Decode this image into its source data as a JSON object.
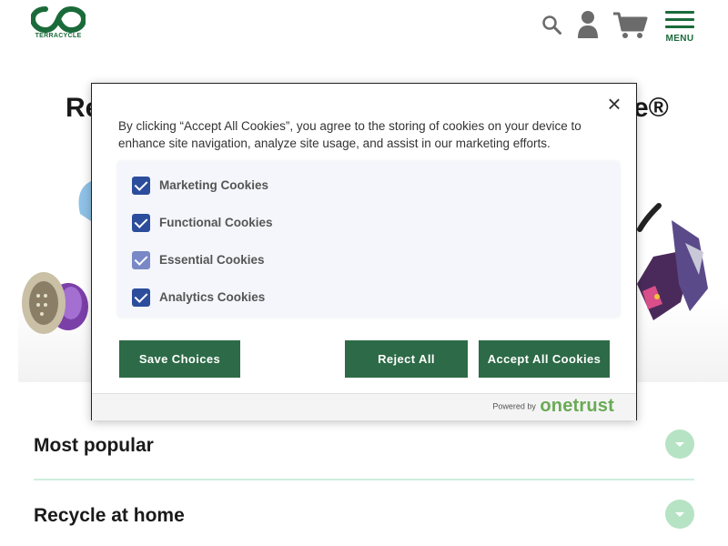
{
  "header": {
    "logo_text": "TERRACYCLE",
    "menu_label": "MENU",
    "icons": [
      "search-icon",
      "user-icon",
      "cart-icon",
      "hamburger-icon"
    ],
    "brand_color": "#1b6b3a"
  },
  "hero": {
    "title_start": "Re",
    "title_end": "e®"
  },
  "accordions": [
    {
      "label": "Most popular"
    },
    {
      "label": "Recycle at home"
    }
  ],
  "cookie_dialog": {
    "description": "By clicking “Accept All Cookies”, you agree to the storing of cookies on your device to enhance site navigation, analyze site usage, and assist in our marketing efforts.",
    "options": [
      {
        "label": "Marketing Cookies",
        "checked": true,
        "disabled": false
      },
      {
        "label": "Functional Cookies",
        "checked": true,
        "disabled": false
      },
      {
        "label": "Essential Cookies",
        "checked": true,
        "disabled": true
      },
      {
        "label": "Analytics Cookies",
        "checked": true,
        "disabled": false
      }
    ],
    "buttons": {
      "save": "Save Choices",
      "reject": "Reject All",
      "accept": "Accept All Cookies"
    },
    "powered_by": "Powered by",
    "powered_brand": "onetrust",
    "button_color": "#2d6a47",
    "checkbox_color": "#2b4d9c"
  }
}
